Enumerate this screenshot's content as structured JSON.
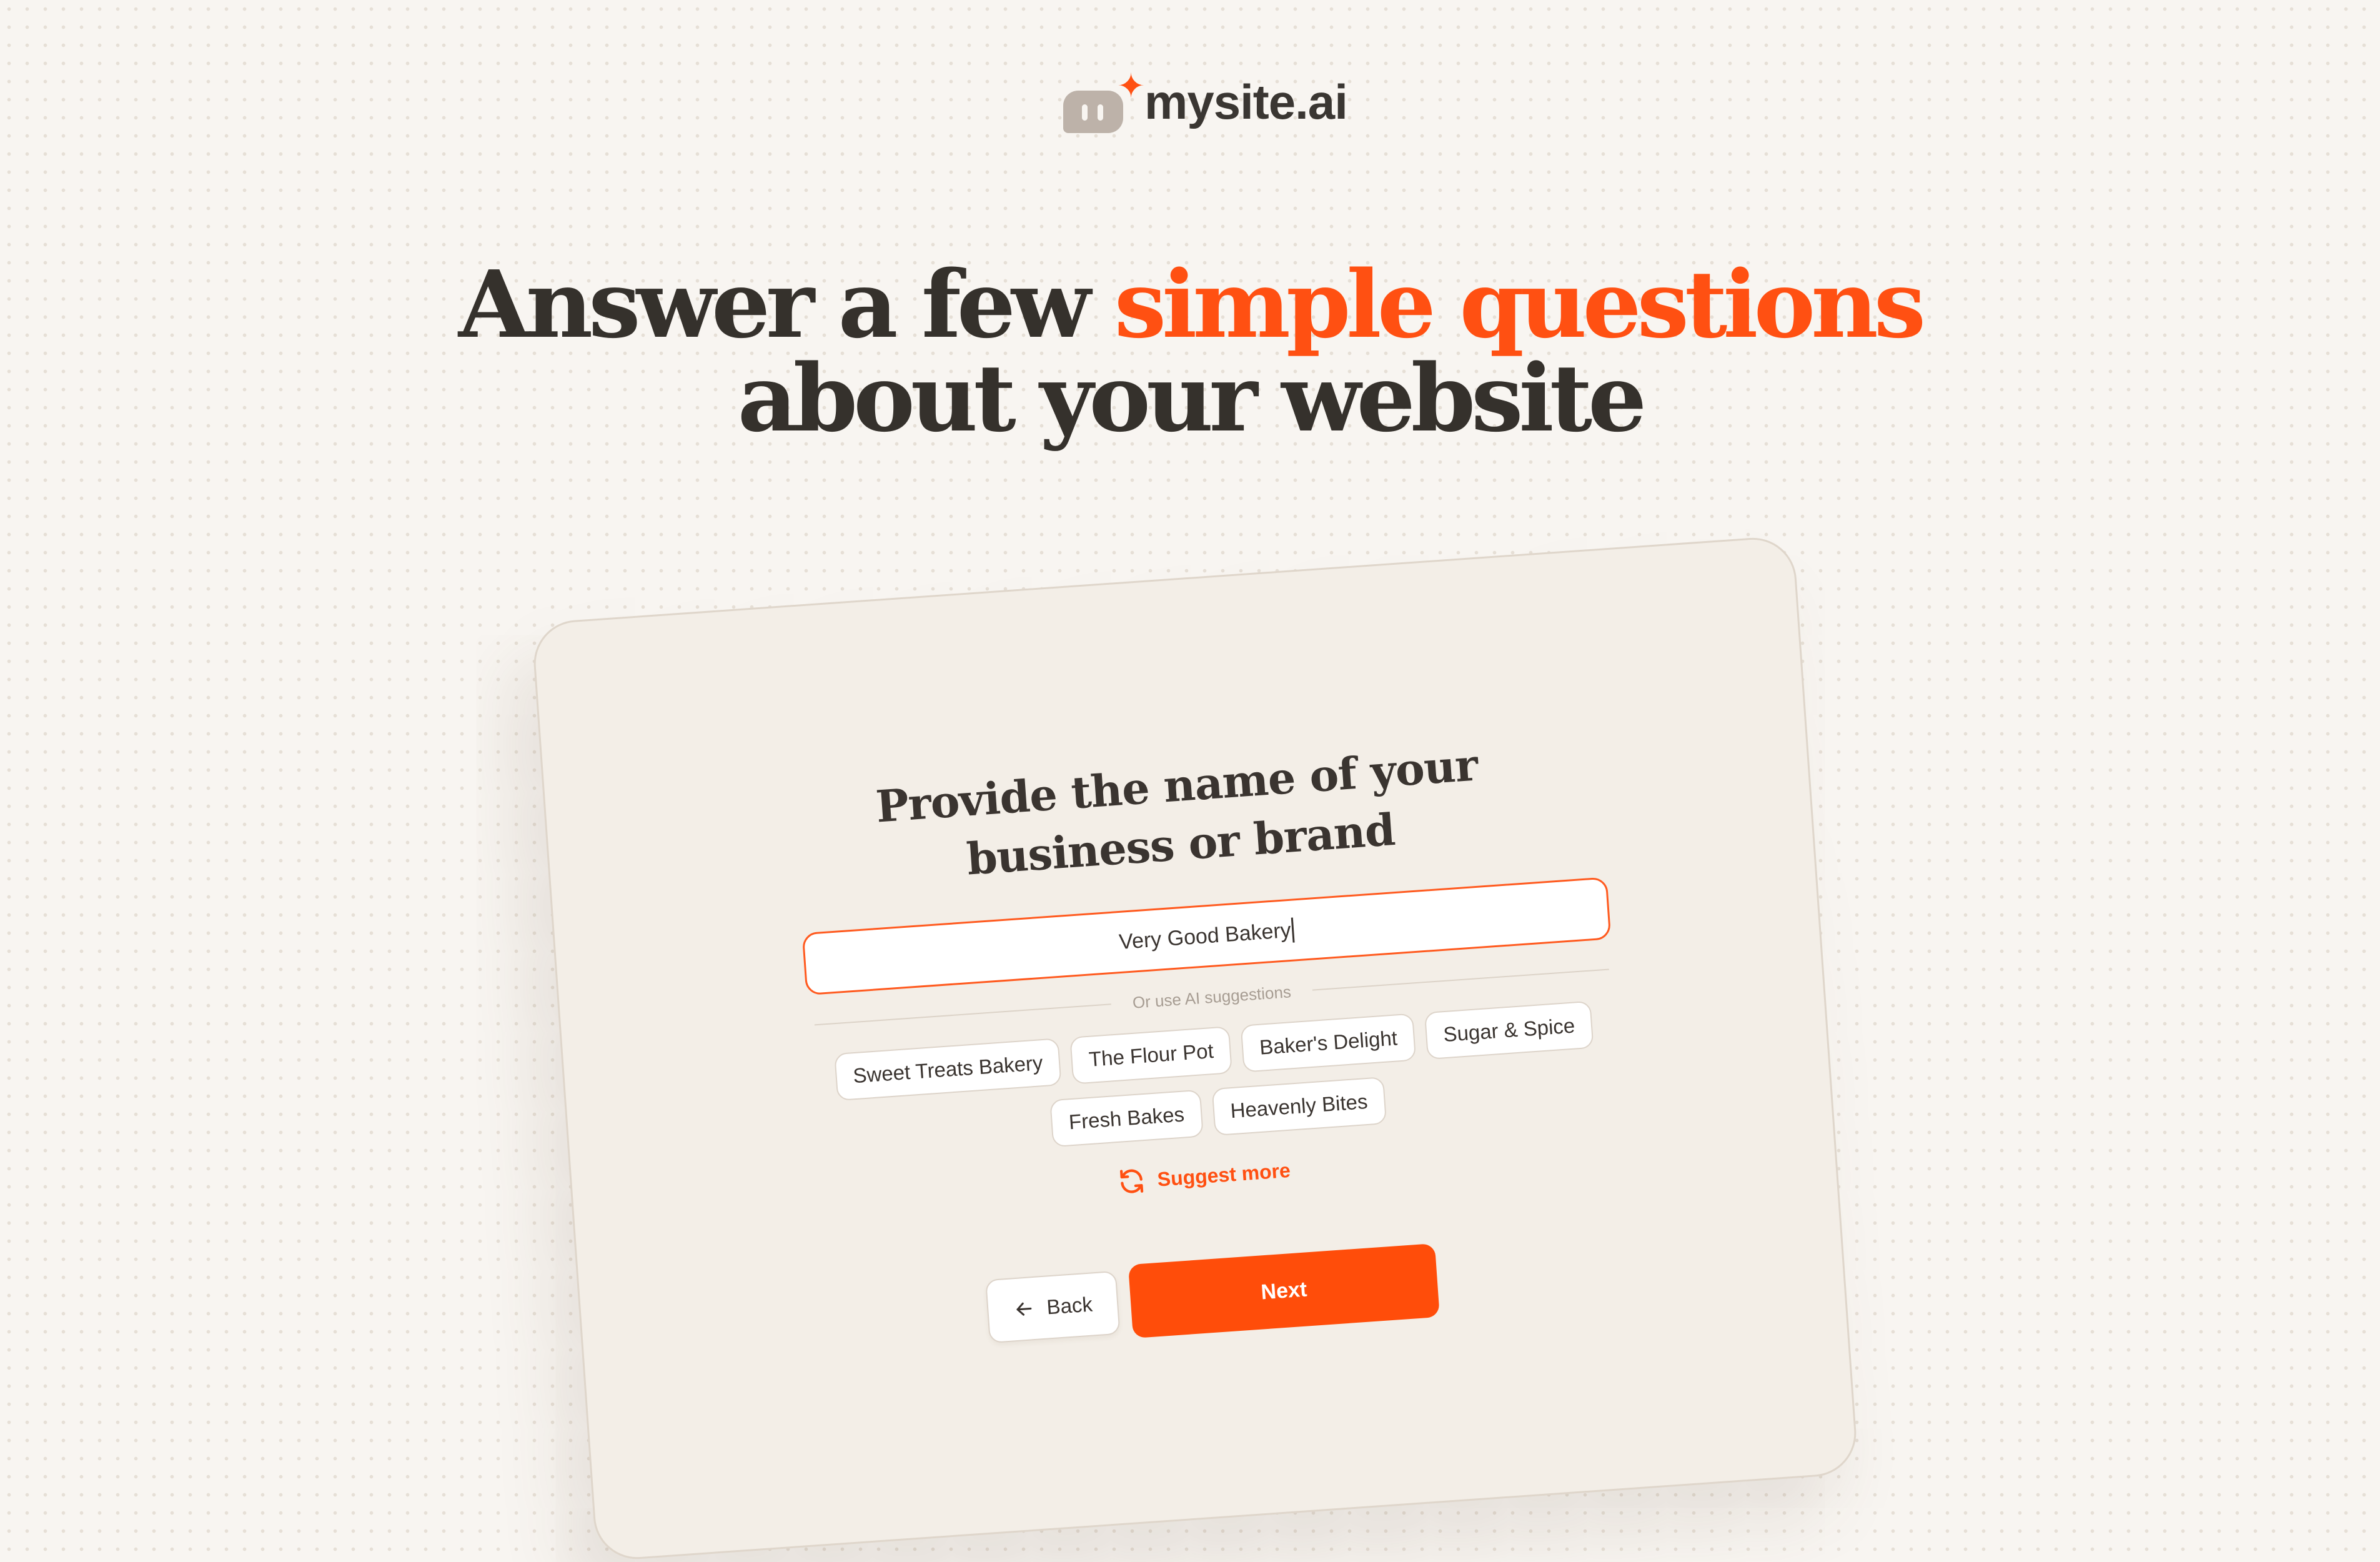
{
  "brand": {
    "name": "mysite.ai",
    "accent_color": "#ff5012",
    "logo_icon": "chat-bubble-face-icon"
  },
  "headline": {
    "part1": "Answer a few",
    "accent": "simple questions",
    "part2": "about your website"
  },
  "form": {
    "question_line1": "Provide the name of your",
    "question_line2": "business or brand",
    "input_value": "Very Good Bakery",
    "divider_label": "Or use AI suggestions",
    "suggestions": [
      "Sweet Treats Bakery",
      "The Flour Pot",
      "Baker's Delight",
      "Sugar & Spice",
      "Fresh Bakes",
      "Heavenly Bites"
    ],
    "suggest_more_label": "Suggest more",
    "back_label": "Back",
    "next_label": "Next"
  }
}
